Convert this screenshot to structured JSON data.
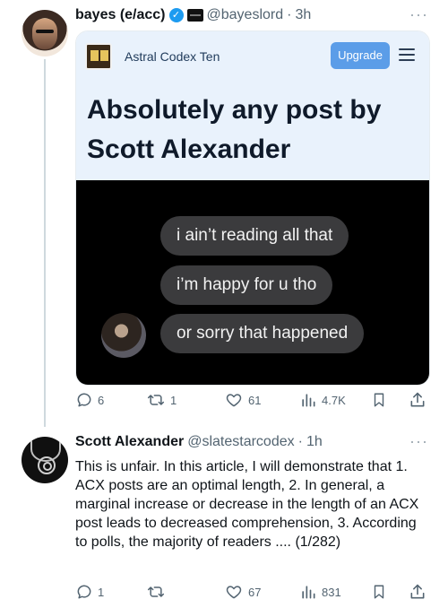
{
  "tweet1": {
    "name": "bayes (e/acc)",
    "handle": "@bayeslord",
    "separator": "·",
    "time": "3h",
    "more_label": "···",
    "card": {
      "site_name": "Astral Codex Ten",
      "upgrade_label": "Upgrade",
      "headline": "Absolutely any post by Scott Alexander",
      "bubbles": [
        "i ain’t reading all that",
        "i’m happy for u tho",
        "or sorry that happened"
      ]
    },
    "actions": {
      "replies": "6",
      "retweets": "1",
      "likes": "61",
      "views": "4.7K"
    }
  },
  "tweet2": {
    "name": "Scott Alexander",
    "handle": "@slatestarcodex",
    "separator": "·",
    "time": "1h",
    "more_label": "···",
    "text": "This is unfair. In this article, I will demonstrate that 1. ACX posts are an optimal length, 2. In general, a marginal increase or decrease in the length of an ACX post leads to decreased comprehension, 3. According to polls, the majority of readers .... (1/282)",
    "actions": {
      "replies": "1",
      "retweets": "",
      "likes": "67",
      "views": "831"
    }
  },
  "colors": {
    "accent": "#1d9bf0",
    "muted": "#536471",
    "upgrade": "#5b9de8",
    "card_bg": "#e9f2fc"
  },
  "icons": [
    "reply-icon",
    "retweet-icon",
    "like-icon",
    "views-icon",
    "bookmark-icon",
    "share-icon",
    "verified-badge-icon",
    "more-icon",
    "menu-icon"
  ]
}
